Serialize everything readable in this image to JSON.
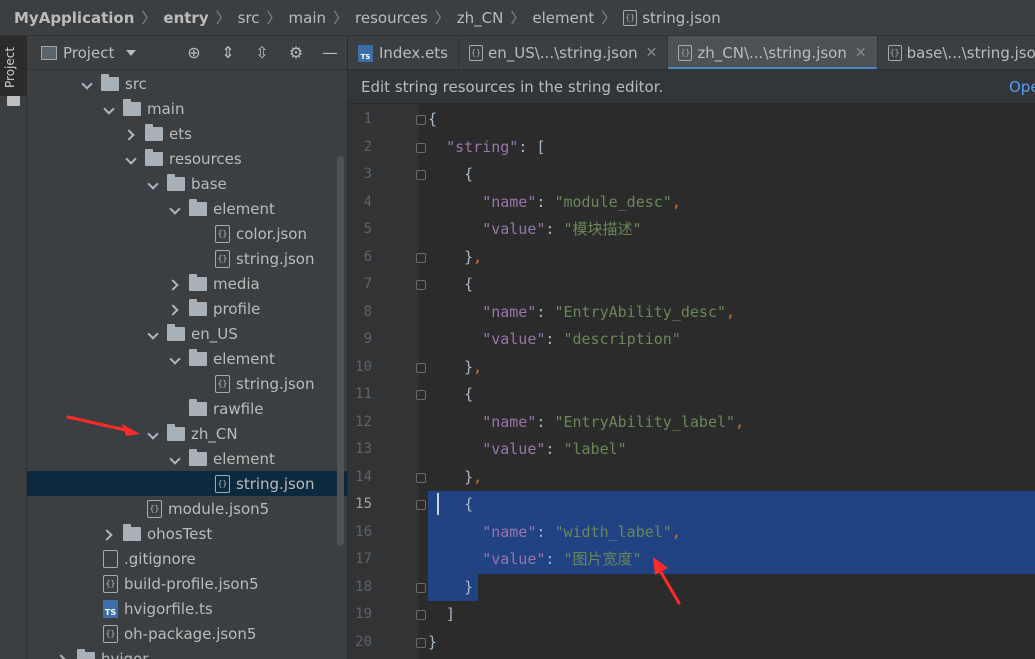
{
  "breadcrumb": {
    "items": [
      "MyApplication",
      "entry",
      "src",
      "main",
      "resources",
      "zh_CN",
      "element",
      "string.json"
    ]
  },
  "toolstrip": {
    "label": "Project"
  },
  "project_panel": {
    "title": "Project",
    "tree": [
      {
        "label": "src",
        "type": "folder",
        "state": "expanded"
      },
      {
        "label": "main",
        "type": "folder",
        "state": "expanded"
      },
      {
        "label": "ets",
        "type": "folder",
        "state": "collapsed"
      },
      {
        "label": "resources",
        "type": "folder",
        "state": "expanded"
      },
      {
        "label": "base",
        "type": "folder",
        "state": "expanded"
      },
      {
        "label": "element",
        "type": "folder",
        "state": "expanded"
      },
      {
        "label": "color.json",
        "type": "json"
      },
      {
        "label": "string.json",
        "type": "json"
      },
      {
        "label": "media",
        "type": "folder",
        "state": "collapsed"
      },
      {
        "label": "profile",
        "type": "folder",
        "state": "collapsed"
      },
      {
        "label": "en_US",
        "type": "folder",
        "state": "expanded"
      },
      {
        "label": "element",
        "type": "folder",
        "state": "expanded"
      },
      {
        "label": "string.json",
        "type": "json"
      },
      {
        "label": "rawfile",
        "type": "folder"
      },
      {
        "label": "zh_CN",
        "type": "folder",
        "state": "expanded"
      },
      {
        "label": "element",
        "type": "folder",
        "state": "expanded"
      },
      {
        "label": "string.json",
        "type": "json",
        "selected": true
      },
      {
        "label": "module.json5",
        "type": "json"
      },
      {
        "label": "ohosTest",
        "type": "folder",
        "state": "collapsed"
      },
      {
        "label": ".gitignore",
        "type": "plain"
      },
      {
        "label": "build-profile.json5",
        "type": "json"
      },
      {
        "label": "hvigorfile.ts",
        "type": "ts"
      },
      {
        "label": "oh-package.json5",
        "type": "json"
      },
      {
        "label": "hvigor",
        "type": "folder",
        "state": "collapsed"
      }
    ]
  },
  "tabs": [
    {
      "label": "Index.ets",
      "icon": "ts",
      "closable": false
    },
    {
      "label": "en_US\\...\\string.json",
      "icon": "json",
      "closable": true
    },
    {
      "label": "zh_CN\\...\\string.json",
      "icon": "json",
      "closable": true,
      "active": true
    },
    {
      "label": "base\\...\\string.json",
      "icon": "json",
      "closable": false
    }
  ],
  "infobar": {
    "message": "Edit string resources in the string editor.",
    "link": "Open editor"
  },
  "editor": {
    "current_line": 15,
    "lines": [
      {
        "n": "1",
        "code": "{"
      },
      {
        "n": "2",
        "code": "  \"string\": ["
      },
      {
        "n": "3",
        "code": "    {"
      },
      {
        "n": "4",
        "code": "      \"name\": \"module_desc\","
      },
      {
        "n": "5",
        "code": "      \"value\": \"模块描述\""
      },
      {
        "n": "6",
        "code": "    },"
      },
      {
        "n": "7",
        "code": "    {"
      },
      {
        "n": "8",
        "code": "      \"name\": \"EntryAbility_desc\","
      },
      {
        "n": "9",
        "code": "      \"value\": \"description\""
      },
      {
        "n": "10",
        "code": "    },"
      },
      {
        "n": "11",
        "code": "    {"
      },
      {
        "n": "12",
        "code": "      \"name\": \"EntryAbility_label\","
      },
      {
        "n": "13",
        "code": "      \"value\": \"label\""
      },
      {
        "n": "14",
        "code": "    },"
      },
      {
        "n": "15",
        "code": "    {"
      },
      {
        "n": "16",
        "code": "      \"name\": \"width_label\","
      },
      {
        "n": "17",
        "code": "      \"value\": \"图片宽度\""
      },
      {
        "n": "18",
        "code": "    }"
      },
      {
        "n": "19",
        "code": "  ]"
      },
      {
        "n": "20",
        "code": "}"
      }
    ]
  },
  "colors": {
    "background": "#2b2b2b",
    "panel": "#3c3f41",
    "selection": "#214283",
    "key": "#9876aa",
    "string": "#6a8759",
    "punct": "#cc7832",
    "annotation_arrow": "#ff2a2a"
  }
}
